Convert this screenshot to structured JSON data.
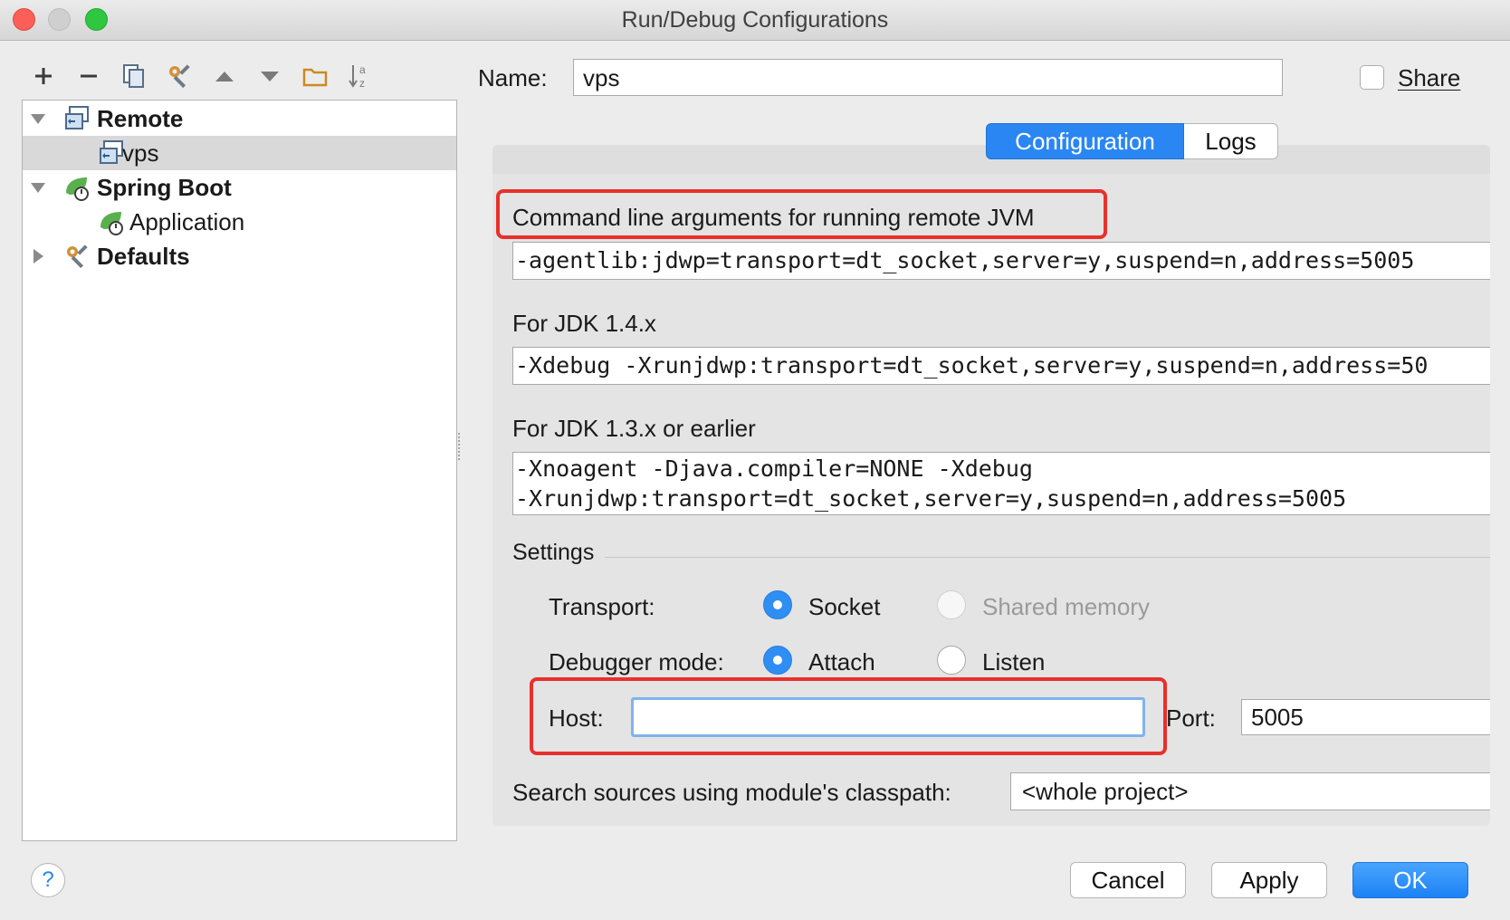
{
  "window": {
    "title": "Run/Debug Configurations",
    "traffic_lights": {
      "close": "#fc5f57",
      "minimize": "#cfcfcf",
      "zoom": "#2ec840"
    }
  },
  "toolbar": {
    "icons": [
      "add-icon",
      "remove-icon",
      "copy-icon",
      "edit-defaults-icon",
      "move-up-icon",
      "move-down-icon",
      "folder-icon",
      "sort-icon"
    ]
  },
  "tree": {
    "items": [
      {
        "label": "Remote",
        "icon": "remote-icon",
        "expanded": true,
        "bold": true
      },
      {
        "label": "vps",
        "icon": "remote-icon",
        "selected": true
      },
      {
        "label": "Spring Boot",
        "icon": "spring-boot-icon",
        "expanded": true,
        "bold": true
      },
      {
        "label": "Application",
        "icon": "spring-boot-icon"
      },
      {
        "label": "Defaults",
        "icon": "wrench-icon",
        "expanded": false,
        "bold": true
      }
    ]
  },
  "name_field": {
    "label": "Name:",
    "value": "vps"
  },
  "share": {
    "label": "Share",
    "checked": false
  },
  "tabs": [
    {
      "label": "Configuration",
      "active": true
    },
    {
      "label": "Logs",
      "active": false
    }
  ],
  "config": {
    "cmd_label": "Command line arguments for running remote JVM",
    "cmd_value": "-agentlib:jdwp=transport=dt_socket,server=y,suspend=n,address=5005",
    "jdk14_label": "For JDK 1.4.x",
    "jdk14_value": "-Xdebug -Xrunjdwp:transport=dt_socket,server=y,suspend=n,address=50",
    "jdk13_label": "For JDK 1.3.x or earlier",
    "jdk13_line1": "-Xnoagent -Djava.compiler=NONE -Xdebug",
    "jdk13_line2": "-Xrunjdwp:transport=dt_socket,server=y,suspend=n,address=5005",
    "settings_label": "Settings",
    "transport_label": "Transport:",
    "transport_options": [
      {
        "label": "Socket",
        "selected": true,
        "enabled": true
      },
      {
        "label": "Shared memory",
        "selected": false,
        "enabled": false
      }
    ],
    "mode_label": "Debugger mode:",
    "mode_options": [
      {
        "label": "Attach",
        "selected": true
      },
      {
        "label": "Listen",
        "selected": false
      }
    ],
    "host_label": "Host:",
    "host_value": "",
    "port_label": "Port:",
    "port_value": "5005",
    "classpath_label": "Search sources using module's classpath:",
    "classpath_value": "<whole project>"
  },
  "buttons": {
    "cancel": "Cancel",
    "apply": "Apply",
    "ok": "OK",
    "help": "?"
  },
  "colors": {
    "accent": "#1b82f4",
    "highlight": "#e8302c"
  }
}
